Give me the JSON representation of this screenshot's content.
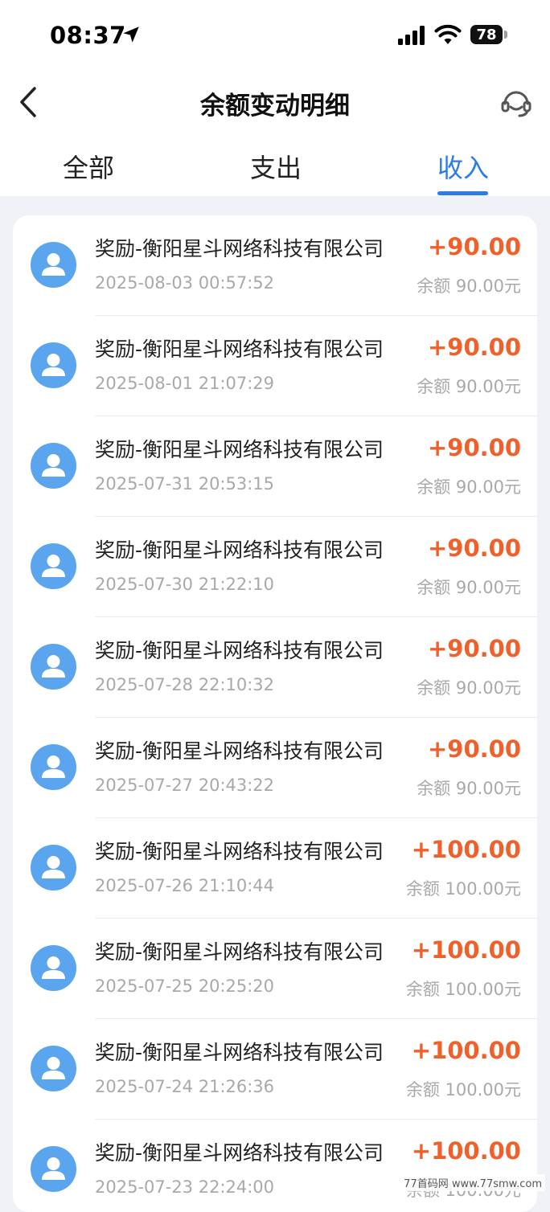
{
  "status_bar": {
    "time": "08:37",
    "battery": "78"
  },
  "nav": {
    "title": "余额变动明细"
  },
  "tabs": [
    {
      "label": "全部"
    },
    {
      "label": "支出"
    },
    {
      "label": "收入",
      "active": true
    }
  ],
  "colors": {
    "accent": "#2b7de1",
    "amount": "#f0602a",
    "avatar": "#5aa5ee"
  },
  "icons": {
    "back": "chevron-left-icon",
    "service": "headset-icon",
    "avatar": "user-icon"
  },
  "records": [
    {
      "title": "奖励-衡阳星斗网络科技有限公司",
      "time": "2025-08-03 00:57:52",
      "amount": "+90.00",
      "balance": "余额 90.00元"
    },
    {
      "title": "奖励-衡阳星斗网络科技有限公司",
      "time": "2025-08-01 21:07:29",
      "amount": "+90.00",
      "balance": "余额 90.00元"
    },
    {
      "title": "奖励-衡阳星斗网络科技有限公司",
      "time": "2025-07-31 20:53:15",
      "amount": "+90.00",
      "balance": "余额 90.00元"
    },
    {
      "title": "奖励-衡阳星斗网络科技有限公司",
      "time": "2025-07-30 21:22:10",
      "amount": "+90.00",
      "balance": "余额 90.00元"
    },
    {
      "title": "奖励-衡阳星斗网络科技有限公司",
      "time": "2025-07-28 22:10:32",
      "amount": "+90.00",
      "balance": "余额 90.00元"
    },
    {
      "title": "奖励-衡阳星斗网络科技有限公司",
      "time": "2025-07-27 20:43:22",
      "amount": "+90.00",
      "balance": "余额 90.00元"
    },
    {
      "title": "奖励-衡阳星斗网络科技有限公司",
      "time": "2025-07-26 21:10:44",
      "amount": "+100.00",
      "balance": "余额 100.00元"
    },
    {
      "title": "奖励-衡阳星斗网络科技有限公司",
      "time": "2025-07-25 20:25:20",
      "amount": "+100.00",
      "balance": "余额 100.00元"
    },
    {
      "title": "奖励-衡阳星斗网络科技有限公司",
      "time": "2025-07-24 21:26:36",
      "amount": "+100.00",
      "balance": "余额 100.00元"
    },
    {
      "title": "奖励-衡阳星斗网络科技有限公司",
      "time": "2025-07-23 22:24:00",
      "amount": "+100.00",
      "balance": "余额 100.00元"
    }
  ],
  "watermark": "77首码网 www.77smw.com"
}
